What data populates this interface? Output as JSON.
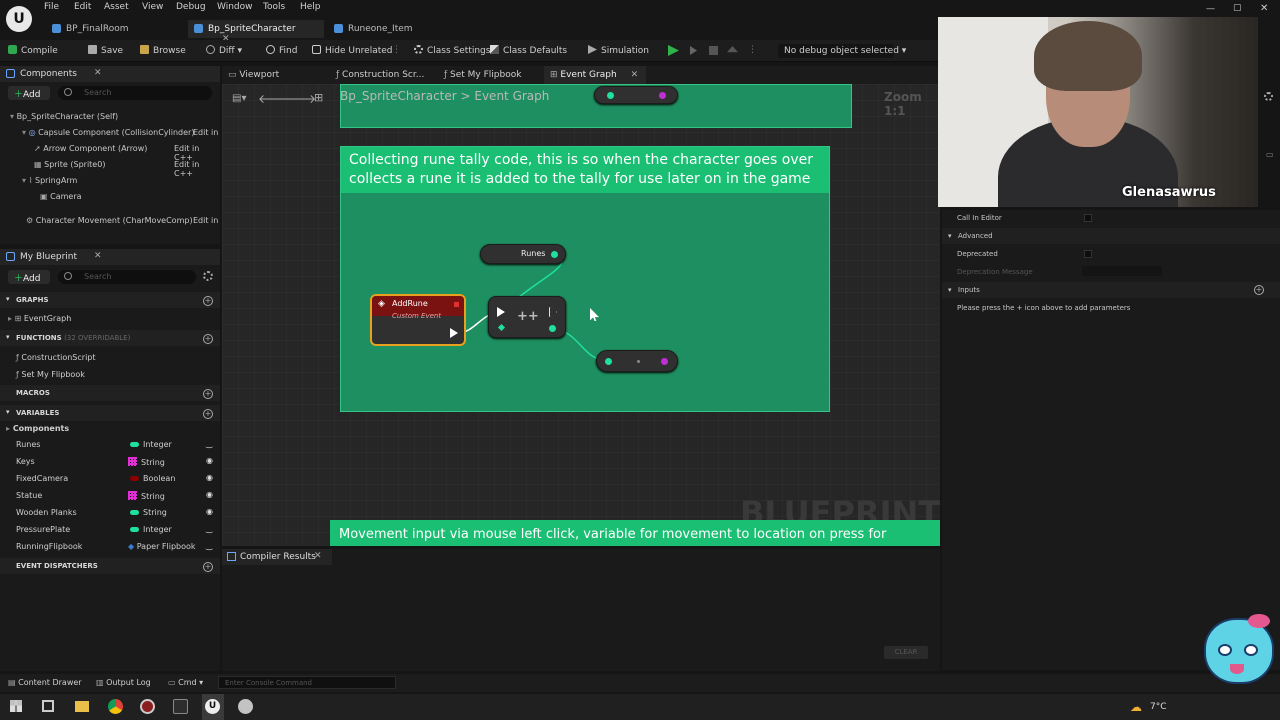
{
  "menu": [
    "File",
    "Edit",
    "Asset",
    "View",
    "Debug",
    "Window",
    "Tools",
    "Help"
  ],
  "doc_tabs": [
    {
      "label": "BP_FinalRoom"
    },
    {
      "label": "Bp_SpriteCharacter"
    },
    {
      "label": "Runeone_Item"
    }
  ],
  "toolbar": {
    "compile": "Compile",
    "save": "Save",
    "browse": "Browse",
    "diff": "Diff",
    "find": "Find",
    "hide_unrelated": "Hide Unrelated",
    "class_settings": "Class Settings",
    "class_defaults": "Class Defaults",
    "simulation": "Simulation",
    "debug_object": "No debug object selected"
  },
  "components_panel": {
    "tab": "Components",
    "add": "Add",
    "search_placeholder": "Search",
    "tree": [
      {
        "label": "Bp_SpriteCharacter (Self)",
        "edit": ""
      },
      {
        "label": "Capsule Component (CollisionCylinder)",
        "edit": "Edit in"
      },
      {
        "label": "Arrow Component (Arrow)",
        "edit": "Edit in C++"
      },
      {
        "label": "Sprite (Sprite0)",
        "edit": "Edit in C++"
      },
      {
        "label": "SpringArm",
        "edit": ""
      },
      {
        "label": "Camera",
        "edit": ""
      },
      {
        "label": "Character Movement (CharMoveComp)",
        "edit": "Edit in"
      }
    ]
  },
  "my_blueprint": {
    "tab": "My Blueprint",
    "add": "Add",
    "search_placeholder": "Search",
    "graphs_header": "GRAPHS",
    "graph_item": "EventGraph",
    "functions_header": "FUNCTIONS",
    "functions_sub": "(32 OVERRIDABLE)",
    "functions": [
      "ConstructionScript",
      "Set My Flipbook"
    ],
    "macros_header": "MACROS",
    "variables_header": "VARIABLES",
    "components_header": "Components",
    "variables": [
      {
        "name": "Runes",
        "type": "Integer",
        "color": "#1fe0a0"
      },
      {
        "name": "Keys",
        "type": "String",
        "color": "#e22fd6"
      },
      {
        "name": "FixedCamera",
        "type": "Boolean",
        "color": "#8c0000"
      },
      {
        "name": "Statue",
        "type": "String",
        "color": "#e22fd6"
      },
      {
        "name": "Wooden Planks",
        "type": "String",
        "color": "#e22fd6"
      },
      {
        "name": "PressurePlate",
        "type": "Integer",
        "color": "#1fe0a0"
      },
      {
        "name": "RunningFlipbook",
        "type": "Paper Flipbook",
        "color": "#3a7bd5"
      }
    ],
    "dispatchers_header": "EVENT DISPATCHERS"
  },
  "editor_tabs": [
    "Viewport",
    "Construction Scr...",
    "Set My Flipbook",
    "Event Graph"
  ],
  "breadcrumb": {
    "root": "Bp_SpriteCharacter",
    "leaf": "Event Graph"
  },
  "zoom": "Zoom 1:1",
  "comment1": "Collecting rune tally code, this is so when the character goes over collects a rune it is added to the tally for use later on in the game",
  "comment2": "Movement input via mouse left click, variable for movement to location on press for",
  "nodes": {
    "runes": "Runes",
    "add_rune": "AddRune",
    "add_rune_sub": "Custom Event",
    "increment": "++"
  },
  "watermark": "BLUEPRINT",
  "compiler": {
    "tab": "Compiler Results",
    "clear": "CLEAR"
  },
  "details": {
    "call_in_editor": "Call In Editor",
    "advanced": "Advanced",
    "deprecated": "Deprecated",
    "deprecation_message": "Deprecation Message",
    "inputs": "Inputs",
    "inputs_hint": "Please press the + icon above to add parameters"
  },
  "webcam": {
    "name": "Glenasawrus"
  },
  "statusbar": {
    "content_drawer": "Content Drawer",
    "output_log": "Output Log",
    "cmd": "Cmd",
    "console_placeholder": "Enter Console Command"
  },
  "taskbar": {
    "temp": "7°C"
  }
}
